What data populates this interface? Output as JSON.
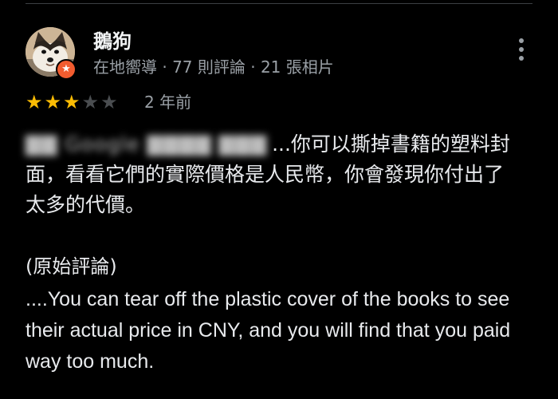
{
  "reviewer": {
    "name": "鵝狗",
    "meta": "在地嚮導 · 77 則評論 · 21 張相片",
    "avatar_icon": "shiba-dog-avatar",
    "badge_icon": "local-guide-star-icon"
  },
  "rating": {
    "value": 3,
    "max": 5
  },
  "review": {
    "date": "2 年前",
    "blurred_prefix": "Google",
    "translated_text": "...你可以撕掉書籍的塑料封面，看看它們的實際價格是人民幣，你會發現你付出了太多的代價。",
    "original_label": "(原始評論)",
    "original_text": "....You can tear off the plastic cover of the books to see their actual price in CNY, and you will find that you paid way too much."
  },
  "colors": {
    "background": "#000000",
    "star_filled": "#fbbc04",
    "star_empty": "#4a4d50",
    "badge": "#f25c2f",
    "secondary_text": "#9aa0a6"
  }
}
